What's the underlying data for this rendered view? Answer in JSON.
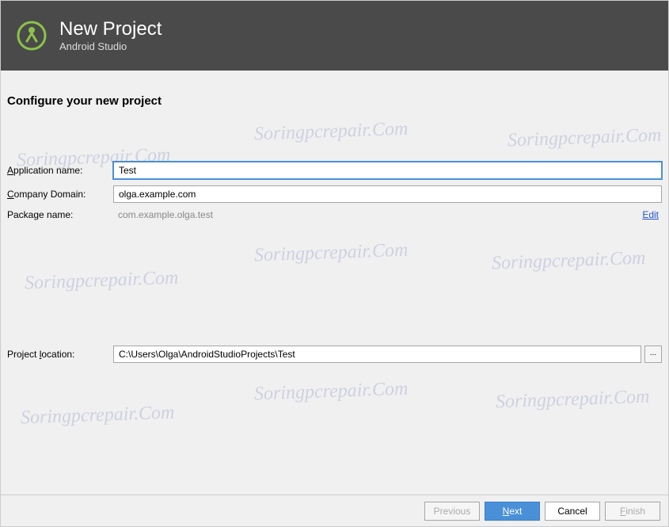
{
  "header": {
    "title": "New Project",
    "subtitle": "Android Studio"
  },
  "page_title": "Configure your new project",
  "fields": {
    "app_name_label_prefix": "A",
    "app_name_label_rest": "pplication name:",
    "app_name_value": "Test",
    "company_domain_label_prefix": "C",
    "company_domain_label_rest": "ompany Domain:",
    "company_domain_value": "olga.example.com",
    "package_name_label": "Package name:",
    "package_name_value": "com.example.olga.test",
    "edit_link": "Edit",
    "project_location_label_prefix": "Project ",
    "project_location_accel": "l",
    "project_location_label_rest": "ocation:",
    "project_location_value": "C:\\Users\\Olga\\AndroidStudioProjects\\Test",
    "browse_label": "..."
  },
  "buttons": {
    "previous": "Previous",
    "next_accel": "N",
    "next_rest": "ext",
    "cancel": "Cancel",
    "finish_accel": "F",
    "finish_rest": "inish"
  },
  "watermark_text": "Soringpcrepair.Com"
}
